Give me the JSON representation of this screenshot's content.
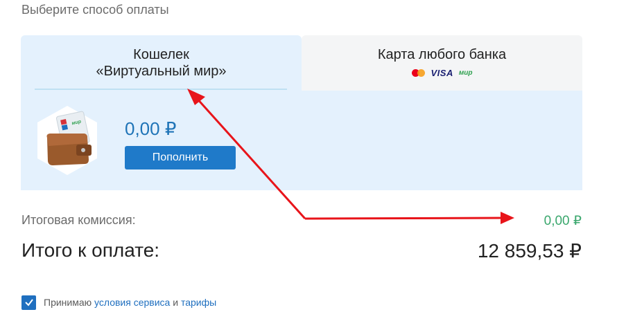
{
  "section_title": "Выберите способ оплаты",
  "tabs": {
    "wallet": {
      "line1": "Кошелек",
      "line2": "«Виртуальный мир»"
    },
    "card": {
      "label": "Карта любого банка",
      "logo_visa": "VISA",
      "logo_mir": "мир"
    }
  },
  "wallet": {
    "balance": "0,00 ₽",
    "topup_label": "Пополнить"
  },
  "summary": {
    "commission_label": "Итоговая комиссия:",
    "commission_value": "0,00 ₽",
    "total_label": "Итого к оплате:",
    "total_value": "12 859,53 ₽"
  },
  "agreement": {
    "prefix": "Принимаю",
    "link1": "условия сервиса",
    "middle": "и",
    "link2": "тарифы",
    "checked": true
  },
  "colors": {
    "accent": "#1f7ac9",
    "panel_bg": "#e4f1fd",
    "commission_green": "#3aa76d",
    "annotation_arrow": "#e8141a"
  }
}
